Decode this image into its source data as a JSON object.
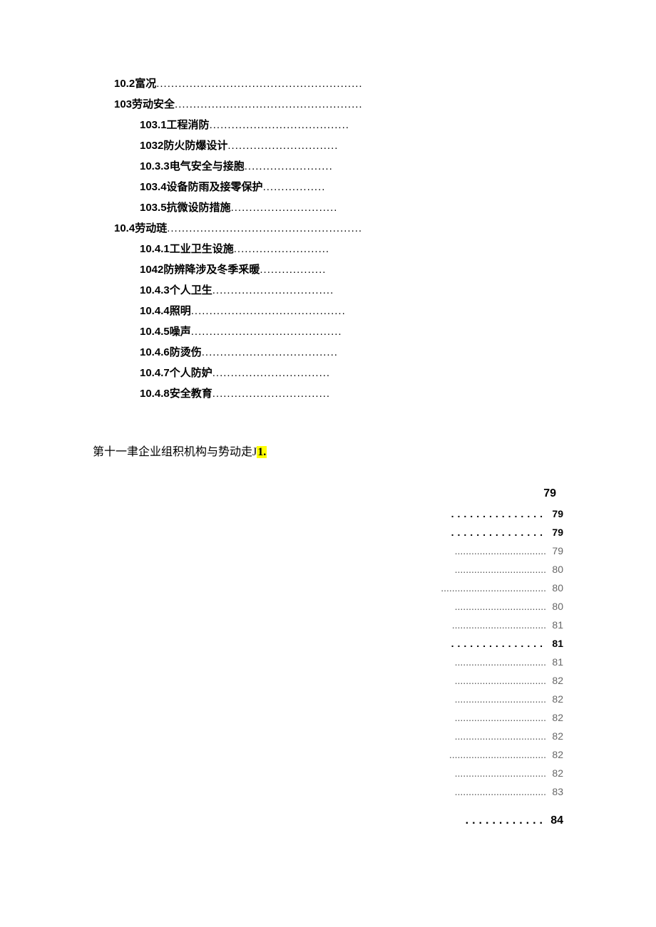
{
  "toc": [
    {
      "level": 1,
      "num": "10.2",
      "text": "富况",
      "dots": "........................................................"
    },
    {
      "level": 1,
      "num": "103",
      "text": "劳动安全",
      "dots": "..................................................."
    },
    {
      "level": 2,
      "num": "103.1",
      "text": "工程消防",
      "dots": "......................................"
    },
    {
      "level": 2,
      "num": "1032",
      "text": "防火防爆设计",
      "dots": " .............................."
    },
    {
      "level": 2,
      "num": "10.3.3",
      "text": "电气安全与接胞",
      "dots": "........................"
    },
    {
      "level": 2,
      "num": "103.4",
      "text": "设备防雨及接零保护",
      "dots": "................."
    },
    {
      "level": 2,
      "num": "103.5",
      "text": "抗微设防措施",
      "dots": " ............................."
    },
    {
      "level": 1,
      "num": "10.4",
      "text": "劳动琏",
      "dots": "....................................................."
    },
    {
      "level": 2,
      "num": "10.4.1",
      "text": "  工业卫生设施",
      "dots": ".........................."
    },
    {
      "level": 2,
      "num": "1042",
      "text": "防辨降涉及冬季釆暖",
      "dots": ".................."
    },
    {
      "level": 2,
      "num": "10.4.3",
      "text": "  个人卫生",
      "dots": "................................."
    },
    {
      "level": 2,
      "num": "10.4.4",
      "text": "  照明",
      "dots": ".........................................."
    },
    {
      "level": 2,
      "num": "10.4.5",
      "text": "  噪声",
      "dots": " ........................................."
    },
    {
      "level": 2,
      "num": "10.4.6",
      "text": "  防烫伤",
      "dots": "....................................."
    },
    {
      "level": 2,
      "num": "10.4.7",
      "text": "  个人防妒",
      "dots": "................................"
    },
    {
      "level": 2,
      "num": "10.4.8",
      "text": "  安全教育",
      "dots": "................................"
    }
  ],
  "chapter": {
    "prefix": "第十一聿企业组积机构与势动走",
    "j": "J",
    "hl": "1."
  },
  "page_top": "79",
  "right": [
    {
      "bold": true,
      "dots": "............... ",
      "page": "79"
    },
    {
      "bold": true,
      "dots": "............... ",
      "page": "79"
    },
    {
      "bold": false,
      "dots": "................................. ",
      "page": "79"
    },
    {
      "bold": false,
      "dots": "................................. ",
      "page": "80"
    },
    {
      "bold": false,
      "dots": "...................................... ",
      "page": "80"
    },
    {
      "bold": false,
      "dots": "................................. ",
      "page": "80"
    },
    {
      "bold": false,
      "dots": ".................................. ",
      "page": "81"
    },
    {
      "bold": true,
      "dots": "............... ",
      "page": "81"
    },
    {
      "bold": false,
      "dots": "................................. ",
      "page": "81"
    },
    {
      "bold": false,
      "dots": "................................. ",
      "page": "82"
    },
    {
      "bold": false,
      "dots": "................................. ",
      "page": "82"
    },
    {
      "bold": false,
      "dots": "................................. ",
      "page": "82"
    },
    {
      "bold": false,
      "dots": "................................. ",
      "page": "82"
    },
    {
      "bold": false,
      "dots": "................................... ",
      "page": "82"
    },
    {
      "bold": false,
      "dots": "................................. ",
      "page": "82"
    },
    {
      "bold": false,
      "dots": "................................. ",
      "page": "83"
    }
  ],
  "right_last": {
    "dots": "............ ",
    "page": "84"
  }
}
